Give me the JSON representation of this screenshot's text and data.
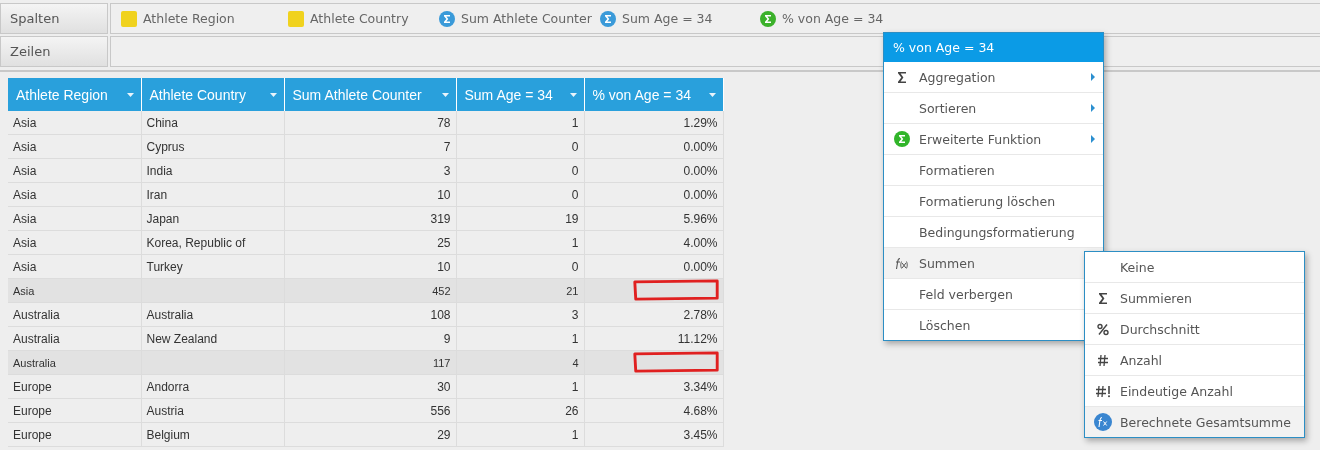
{
  "shelves": [
    {
      "label": "Spalten",
      "fields": [
        {
          "label": "Athlete Region",
          "kind": "dimension"
        },
        {
          "label": "Athlete Country",
          "kind": "dimension"
        },
        {
          "label": "Sum Athlete Counter",
          "kind": "measure"
        },
        {
          "label": "Sum Age = 34",
          "kind": "measure"
        },
        {
          "label": "% von Age = 34",
          "kind": "calculated"
        }
      ]
    },
    {
      "label": "Zeilen"
    }
  ],
  "table": {
    "columns": [
      "Athlete Region",
      "Athlete Country",
      "Sum Athlete Counter",
      "Sum Age = 34",
      "% von Age = 34"
    ],
    "rows": [
      {
        "kind": "data",
        "cells": [
          "Asia",
          "China",
          "78",
          "1",
          "1.29%"
        ]
      },
      {
        "kind": "data",
        "cells": [
          "Asia",
          "Cyprus",
          "7",
          "0",
          "0.00%"
        ]
      },
      {
        "kind": "data",
        "cells": [
          "Asia",
          "India",
          "3",
          "0",
          "0.00%"
        ]
      },
      {
        "kind": "data",
        "cells": [
          "Asia",
          "Iran",
          "10",
          "0",
          "0.00%"
        ]
      },
      {
        "kind": "data",
        "cells": [
          "Asia",
          "Japan",
          "319",
          "19",
          "5.96%"
        ]
      },
      {
        "kind": "data",
        "cells": [
          "Asia",
          "Korea, Republic of",
          "25",
          "1",
          "4.00%"
        ]
      },
      {
        "kind": "data",
        "cells": [
          "Asia",
          "Turkey",
          "10",
          "0",
          "0.00%"
        ]
      },
      {
        "kind": "subtotal",
        "marked": true,
        "cells": [
          "Asia",
          "",
          "452",
          "21",
          ""
        ]
      },
      {
        "kind": "data",
        "cells": [
          "Australia",
          "Australia",
          "108",
          "3",
          "2.78%"
        ]
      },
      {
        "kind": "data",
        "cells": [
          "Australia",
          "New Zealand",
          "9",
          "1",
          "11.12%"
        ]
      },
      {
        "kind": "subtotal",
        "marked": true,
        "cells": [
          "Australia",
          "",
          "117",
          "4",
          ""
        ]
      },
      {
        "kind": "data",
        "cells": [
          "Europe",
          "Andorra",
          "30",
          "1",
          "3.34%"
        ]
      },
      {
        "kind": "data",
        "cells": [
          "Europe",
          "Austria",
          "556",
          "26",
          "4.68%"
        ]
      },
      {
        "kind": "data",
        "cells": [
          "Europe",
          "Belgium",
          "29",
          "1",
          "3.45%"
        ]
      }
    ]
  },
  "context_menu": {
    "title": "% von Age = 34",
    "items": [
      {
        "label": "Aggregation",
        "kind": "sigma",
        "submenu": true,
        "highlighted": false
      },
      {
        "label": "Sortieren",
        "kind": "plain",
        "submenu": true,
        "highlighted": false
      },
      {
        "label": "Erweiterte Funktion",
        "kind": "calculated",
        "submenu": true,
        "highlighted": false
      },
      {
        "label": "Formatieren",
        "kind": "plain",
        "submenu": false,
        "highlighted": false
      },
      {
        "label": "Formatierung löschen",
        "kind": "plain",
        "submenu": false,
        "highlighted": false
      },
      {
        "label": "Bedingungsformatierung",
        "kind": "plain",
        "submenu": false,
        "highlighted": false
      },
      {
        "label": "Summen",
        "kind": "function",
        "submenu": false,
        "highlighted": true
      },
      {
        "label": "Feld verbergen",
        "kind": "plain",
        "submenu": false,
        "highlighted": false
      },
      {
        "label": "Löschen",
        "kind": "plain",
        "submenu": false,
        "highlighted": false
      }
    ]
  },
  "submenu": {
    "items": [
      {
        "label": "Keine",
        "kind": "plain",
        "highlighted": false
      },
      {
        "label": "Summieren",
        "kind": "sigma",
        "highlighted": false
      },
      {
        "label": "Durchschnitt",
        "kind": "percent",
        "highlighted": false
      },
      {
        "label": "Anzahl",
        "kind": "count",
        "highlighted": false
      },
      {
        "label": "Eindeutige Anzahl",
        "kind": "distinct",
        "highlighted": false
      },
      {
        "label": "Berechnete Gesamtsumme",
        "kind": "computed",
        "highlighted": true
      }
    ]
  }
}
